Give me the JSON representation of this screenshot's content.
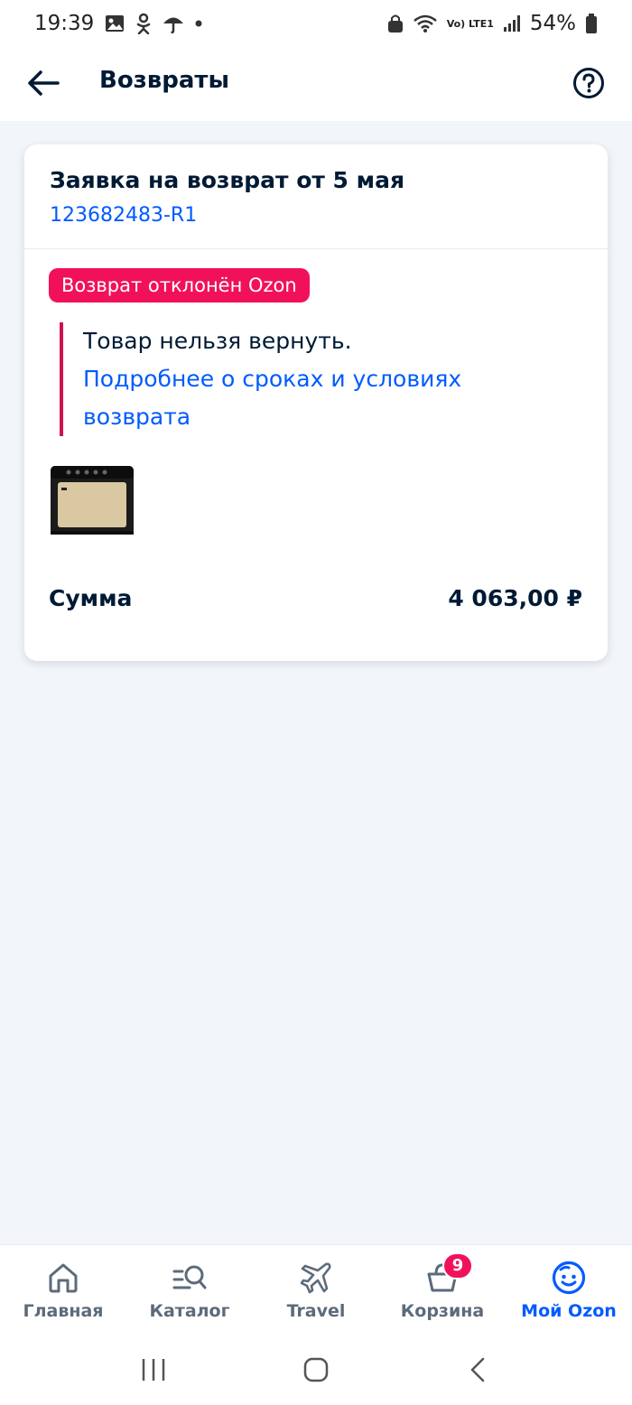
{
  "status_bar": {
    "time": "19:39",
    "battery": "54%",
    "network_label": "Vo) LTE1"
  },
  "header": {
    "title": "Возвраты"
  },
  "card": {
    "title": "Заявка на возврат от 5 мая",
    "order_number": "123682483-R1",
    "status_badge": "Возврат отклонён Ozon",
    "notice_text": "Товар нельзя вернуть.",
    "notice_link": "Подробнее о сроках и условиях возврата",
    "sum_label": "Сумма",
    "sum_value": "4 063,00 ₽"
  },
  "bottom_nav": {
    "items": [
      {
        "label": "Главная",
        "icon": "home-icon"
      },
      {
        "label": "Каталог",
        "icon": "catalog-search-icon"
      },
      {
        "label": "Travel",
        "icon": "airplane-icon"
      },
      {
        "label": "Корзина",
        "icon": "basket-icon"
      },
      {
        "label": "Мой Ozon",
        "icon": "smiley-icon"
      }
    ],
    "cart_count": "9",
    "active_index": 4
  },
  "colors": {
    "accent": "#005bff",
    "badge": "#f1115a",
    "text": "#001a34",
    "background": "#f2f5f9"
  }
}
